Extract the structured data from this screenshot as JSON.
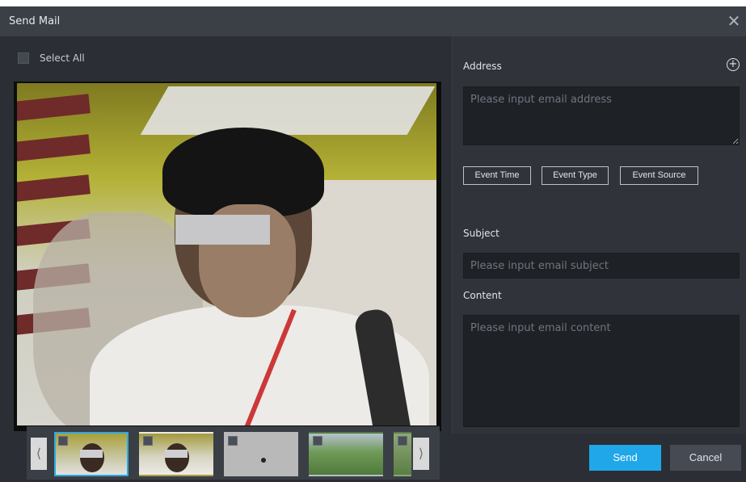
{
  "dialog": {
    "title": "Send Mail",
    "close_icon": "close-icon"
  },
  "left": {
    "select_all_label": "Select All",
    "preview_image": "person-snapshot",
    "thumbnails": [
      {
        "name": "thumb-1",
        "selected": true
      },
      {
        "name": "thumb-2",
        "selected": false
      },
      {
        "name": "thumb-3",
        "selected": false
      },
      {
        "name": "thumb-4",
        "selected": false
      },
      {
        "name": "thumb-5",
        "selected": false
      }
    ],
    "prev_glyph": "⟨",
    "next_glyph": "⟩"
  },
  "address": {
    "label": "Address",
    "placeholder": "Please input email address",
    "add_icon": "add-circle-icon"
  },
  "tags": {
    "event_time": "Event Time",
    "event_type": "Event Type",
    "event_source": "Event Source"
  },
  "subject": {
    "label": "Subject",
    "placeholder": "Please input email subject"
  },
  "content": {
    "label": "Content",
    "placeholder": "Please input email content"
  },
  "buttons": {
    "send": "Send",
    "cancel": "Cancel"
  },
  "colors": {
    "accent": "#1fa7e9",
    "dialog_bg": "#2b2f35",
    "titlebar_bg": "#3b3f46"
  }
}
